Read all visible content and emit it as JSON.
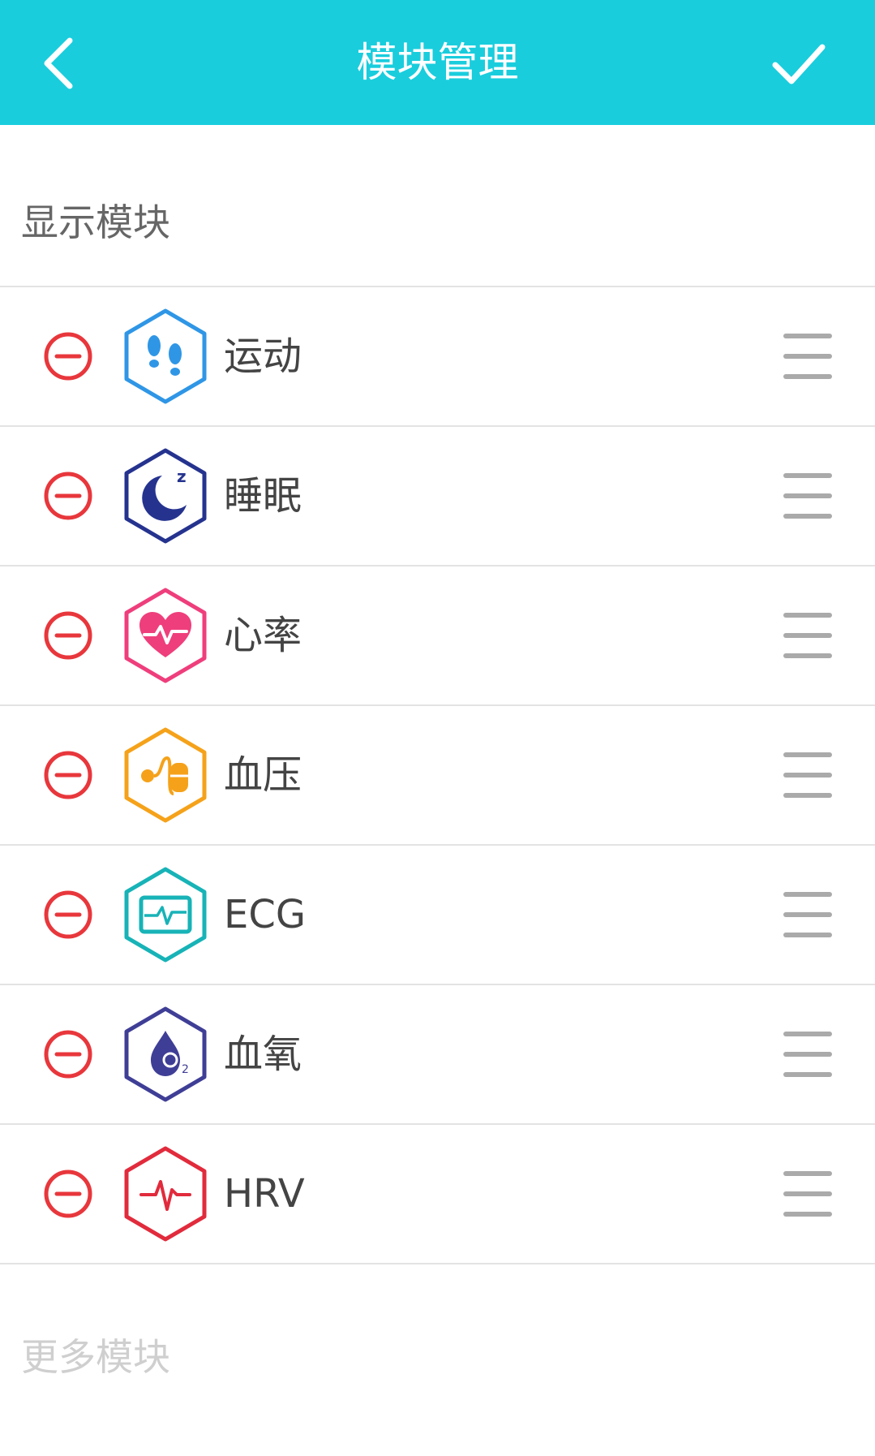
{
  "header": {
    "title": "模块管理",
    "background_color": "#19cddd",
    "back_icon": "chevron-left-icon",
    "confirm_icon": "checkmark-icon"
  },
  "sections": {
    "shown_title": "显示模块",
    "more_title": "更多模块"
  },
  "modules": [
    {
      "label": "运动",
      "icon": "footprints-icon",
      "color": "#2f96e6"
    },
    {
      "label": "睡眠",
      "icon": "moon-sleep-icon",
      "color": "#25338f"
    },
    {
      "label": "心率",
      "icon": "heart-pulse-icon",
      "color": "#ef3e7c"
    },
    {
      "label": "血压",
      "icon": "blood-pressure-icon",
      "color": "#f5a21a"
    },
    {
      "label": "ECG",
      "icon": "ecg-monitor-icon",
      "color": "#17b3b7"
    },
    {
      "label": "血氧",
      "icon": "oxygen-drop-icon",
      "color": "#3f3e96"
    },
    {
      "label": "HRV",
      "icon": "hrv-pulse-icon",
      "color": "#e12b3c"
    }
  ],
  "colors": {
    "remove": "#e8373c",
    "handle": "#aaaaaa"
  }
}
